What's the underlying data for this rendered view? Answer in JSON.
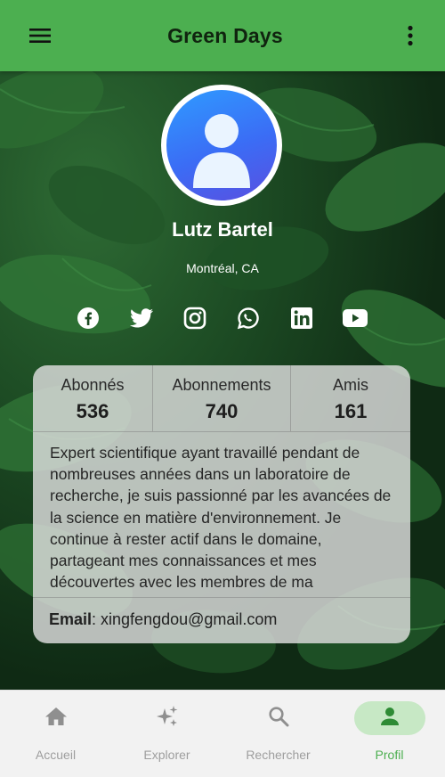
{
  "app": {
    "title": "Green Days"
  },
  "profile": {
    "name": "Lutz Bartel",
    "location": "Montréal, CA",
    "socials": [
      "facebook",
      "twitter",
      "instagram",
      "whatsapp",
      "linkedin",
      "youtube"
    ]
  },
  "stats": [
    {
      "label": "Abonnés",
      "value": "536"
    },
    {
      "label": "Abonnements",
      "value": "740"
    },
    {
      "label": "Amis",
      "value": "161"
    }
  ],
  "bio": "Expert scientifique ayant travaillé pendant de nombreuses années dans un laboratoire de recherche, je suis passionné par les avancées de la science en matière d'environnement. Je continue à rester actif dans le domaine, partageant mes connaissances et mes découvertes avec les membres de ma communauté.",
  "contact": {
    "email_label": "Email",
    "email_value": ": xingfengdou@gmail.com"
  },
  "nav": [
    {
      "label": "Accueil",
      "icon": "home-icon",
      "active": false
    },
    {
      "label": "Explorer",
      "icon": "sparkle-icon",
      "active": false
    },
    {
      "label": "Rechercher",
      "icon": "search-icon",
      "active": false
    },
    {
      "label": "Profil",
      "icon": "person-icon",
      "active": true
    }
  ],
  "colors": {
    "primary": "#4caf50",
    "active_pill": "#c7e8c5",
    "nav_inactive": "#9e9e9e"
  }
}
